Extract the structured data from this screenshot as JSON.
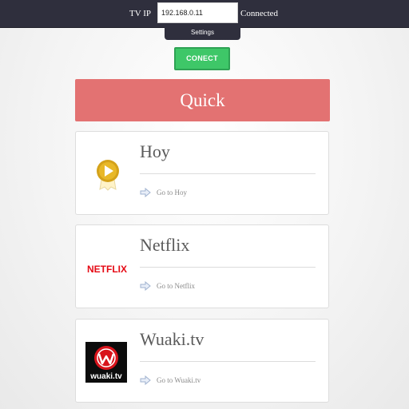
{
  "header": {
    "tv_ip_label": "TV IP",
    "ip_value": "192.168.0.11",
    "status": "Connected",
    "settings_label": "Settings"
  },
  "connect_button": "CONECT",
  "quick_banner": "Quick",
  "colors": {
    "topbar": "#2f2f3d",
    "connect": "#3ec768",
    "quick": "#e37272",
    "hoy_gold": "#d4a21a",
    "netflix_red": "#e50914",
    "wuaki_red": "#d8131b"
  },
  "cards": [
    {
      "title": "Hoy",
      "link": "Go to Hoy",
      "icon": "hoy-play-icon"
    },
    {
      "title": "Netflix",
      "link": "Go to Netflix",
      "logo_text": "NETFLIX"
    },
    {
      "title": "Wuaki.tv",
      "link": "Go to Wuaki.tv",
      "logo_text": "wuaki.tv"
    }
  ]
}
